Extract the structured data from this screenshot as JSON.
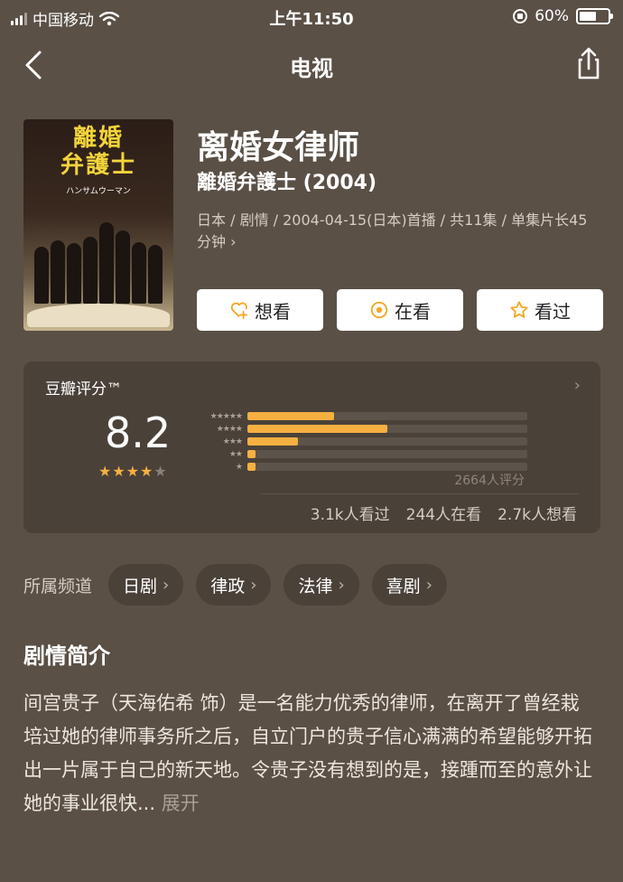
{
  "status_bar": {
    "carrier": "中国移动",
    "time": "上午11:50",
    "battery": "60%",
    "battery_level": 0.6
  },
  "nav": {
    "title": "电视"
  },
  "show": {
    "title": "离婚女律师",
    "original_title": "離婚弁護士 (2004)",
    "meta": "日本 / 剧情 / 2004-04-15(日本)首播 / 共11集 / 单集片长45分钟",
    "meta_chevron": "›",
    "poster": {
      "title_line1": "離婚",
      "title_line2": "弁護士",
      "subtitle": "ハンサムウーマン"
    }
  },
  "actions": [
    {
      "label": "想看",
      "icon": "heart-plus-icon"
    },
    {
      "label": "在看",
      "icon": "target-icon"
    },
    {
      "label": "看过",
      "icon": "star-outline-icon"
    }
  ],
  "rating": {
    "label": "豆瓣评分™",
    "chevron": "›",
    "score": "8.2",
    "stars_value": 4,
    "stars_max": 5,
    "distribution": [
      {
        "stars": 5,
        "fraction": 0.31
      },
      {
        "stars": 4,
        "fraction": 0.5
      },
      {
        "stars": 3,
        "fraction": 0.18
      },
      {
        "stars": 2,
        "fraction": 0.03
      },
      {
        "stars": 1,
        "fraction": 0.03
      }
    ],
    "count": "2664人评分",
    "watched": "3.1k人看过",
    "watching": "244人在看",
    "want": "2.7k人想看",
    "colors": {
      "accent": "#f5b041",
      "track": "#5c534a"
    }
  },
  "channels": {
    "label": "所属频道",
    "items": [
      "日剧",
      "律政",
      "法律",
      "喜剧"
    ]
  },
  "synopsis": {
    "heading": "剧情简介",
    "text": "间宫贵子（天海佑希 饰）是一名能力优秀的律师，在离开了曾经栽培过她的律师事务所之后，自立门户的贵子信心满满的希望能够开拓出一片属于自己的新天地。令贵子没有想到的是，接踵而至的意外让她的事业很快...",
    "more": "展开"
  }
}
